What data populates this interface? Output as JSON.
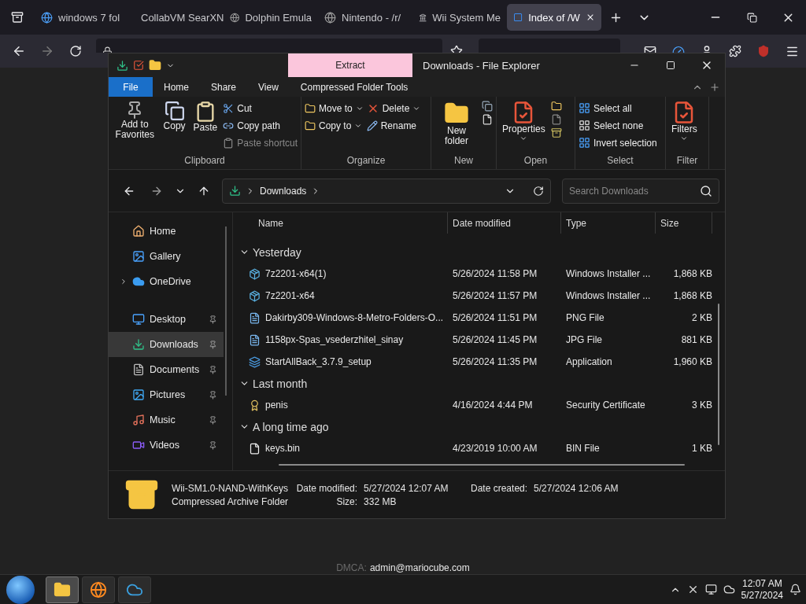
{
  "browser": {
    "tabs": [
      {
        "title": "windows 7 fol",
        "selected": false
      },
      {
        "title": "CollabVM SearXN",
        "selected": false
      },
      {
        "title": "Dolphin Emula",
        "selected": false
      },
      {
        "title": "Nintendo - /r/",
        "selected": false
      },
      {
        "title": "Wii System Me",
        "selected": false
      },
      {
        "title": "Index of /W",
        "selected": true
      }
    ]
  },
  "page": {
    "footer_label": "DMCA:",
    "footer_email": "admin@mariocube.com"
  },
  "explorer": {
    "title": "Downloads - File Explorer",
    "context_tab": "Extract",
    "file_tab": "File",
    "ribbon_tabs": [
      "Home",
      "Share",
      "View",
      "Compressed Folder Tools"
    ],
    "ribbon_groups": [
      {
        "label": "Clipboard",
        "items": [
          {
            "label": "Add to Favorites",
            "kind": "large"
          },
          {
            "label": "Copy",
            "kind": "large"
          },
          {
            "label": "Paste",
            "kind": "large"
          },
          {
            "label": "Cut",
            "kind": "small",
            "disabled": false
          },
          {
            "label": "Copy path",
            "kind": "small",
            "disabled": false
          },
          {
            "label": "Paste shortcut",
            "kind": "small",
            "disabled": true
          }
        ]
      },
      {
        "label": "Organize",
        "items": [
          {
            "label": "Move to",
            "kind": "small",
            "dropdown": true
          },
          {
            "label": "Copy to",
            "kind": "small",
            "dropdown": true
          },
          {
            "label": "Delete",
            "kind": "small",
            "dropdown": true
          },
          {
            "label": "Rename",
            "kind": "small",
            "dropdown": false
          }
        ]
      },
      {
        "label": "New",
        "items": [
          {
            "label": "New folder",
            "kind": "large"
          }
        ]
      },
      {
        "label": "Open",
        "items": [
          {
            "label": "Properties",
            "kind": "large",
            "dropdown": true
          }
        ]
      },
      {
        "label": "Select",
        "items": [
          {
            "label": "Select all",
            "kind": "small"
          },
          {
            "label": "Select none",
            "kind": "small"
          },
          {
            "label": "Invert selection",
            "kind": "small"
          }
        ]
      },
      {
        "label": "Filter",
        "items": [
          {
            "label": "Filters",
            "kind": "large",
            "dropdown": true
          }
        ]
      }
    ],
    "address": {
      "crumb": "Downloads",
      "search_placeholder": "Search Downloads"
    },
    "sidebar": {
      "items": [
        {
          "label": "Home",
          "selected": false,
          "pinned": false
        },
        {
          "label": "Gallery",
          "selected": false,
          "pinned": false
        },
        {
          "label": "OneDrive",
          "selected": false,
          "pinned": false,
          "expanded": false
        },
        {
          "label": "Desktop",
          "selected": false,
          "pinned": true
        },
        {
          "label": "Downloads",
          "selected": true,
          "pinned": true
        },
        {
          "label": "Documents",
          "selected": false,
          "pinned": true
        },
        {
          "label": "Pictures",
          "selected": false,
          "pinned": true
        },
        {
          "label": "Music",
          "selected": false,
          "pinned": true
        },
        {
          "label": "Videos",
          "selected": false,
          "pinned": true
        }
      ]
    },
    "columns": [
      "Name",
      "Date modified",
      "Type",
      "Size"
    ],
    "groups": [
      {
        "label": "Yesterday",
        "expanded": true,
        "rows": [
          {
            "name": "7z2201-x64(1)",
            "date": "5/26/2024 11:58 PM",
            "type": "Windows Installer ...",
            "size": "1,868 KB",
            "kind": "installer"
          },
          {
            "name": "7z2201-x64",
            "date": "5/26/2024 11:57 PM",
            "type": "Windows Installer ...",
            "size": "1,868 KB",
            "kind": "installer"
          },
          {
            "name": "Dakirby309-Windows-8-Metro-Folders-O...",
            "date": "5/26/2024 11:51 PM",
            "type": "PNG File",
            "size": "2 KB",
            "kind": "image"
          },
          {
            "name": "1158px-Spas_vsederzhitel_sinay",
            "date": "5/26/2024 11:45 PM",
            "type": "JPG File",
            "size": "881 KB",
            "kind": "image"
          },
          {
            "name": "StartAllBack_3.7.9_setup",
            "date": "5/26/2024 11:35 PM",
            "type": "Application",
            "size": "1,960 KB",
            "kind": "application"
          }
        ]
      },
      {
        "label": "Last month",
        "expanded": true,
        "rows": [
          {
            "name": "penis",
            "date": "4/16/2024 4:44 PM",
            "type": "Security Certificate",
            "size": "3 KB",
            "kind": "certificate"
          }
        ]
      },
      {
        "label": "A long time ago",
        "expanded": true,
        "rows": [
          {
            "name": "keys.bin",
            "date": "4/23/2019 10:00 AM",
            "type": "BIN File",
            "size": "1 KB",
            "kind": "file"
          }
        ]
      }
    ],
    "details": {
      "name": "Wii-SM1.0-NAND-WithKeys",
      "type": "Compressed Archive Folder",
      "fields": [
        {
          "label": "Date modified:",
          "value": "5/27/2024 12:07 AM"
        },
        {
          "label": "Date created:",
          "value": "5/27/2024 12:06 AM"
        },
        {
          "label": "Size:",
          "value": "332 MB"
        }
      ]
    }
  },
  "taskbar": {
    "apps": [
      {
        "selected": true
      },
      {
        "selected": false
      },
      {
        "selected": false
      }
    ],
    "time": "12:07 AM",
    "date": "5/27/2024"
  }
}
